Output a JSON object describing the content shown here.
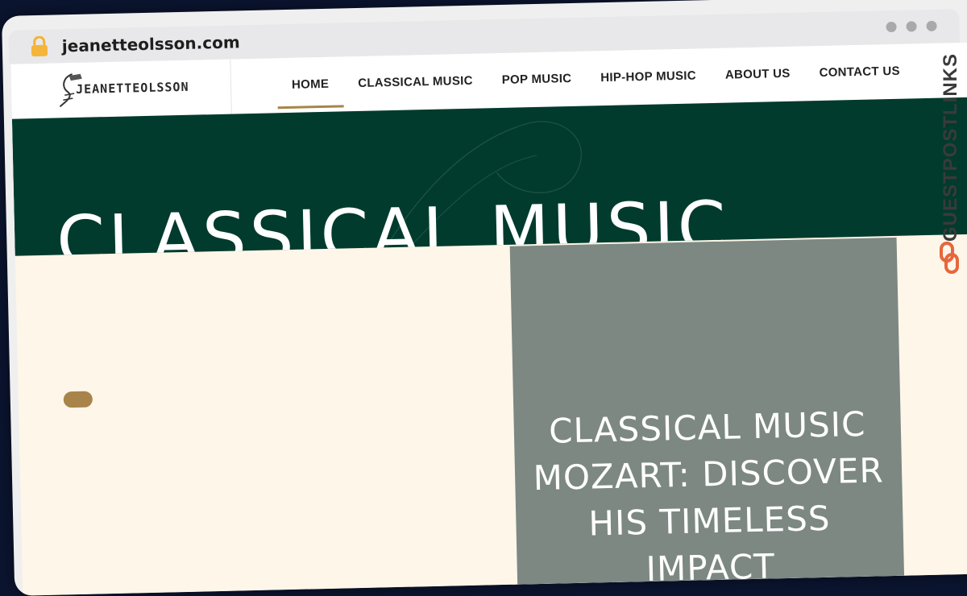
{
  "browser": {
    "url": "jeanetteolsson.com",
    "lock_icon": "lock-icon",
    "window_dots": 3
  },
  "site": {
    "logo_text": "JEANETTEOLSSON",
    "nav": [
      {
        "label": "HOME",
        "active": true
      },
      {
        "label": "CLASSICAL MUSIC",
        "active": false
      },
      {
        "label": "POP MUSIC",
        "active": false
      },
      {
        "label": "HIP-HOP MUSIC",
        "active": false
      },
      {
        "label": "ABOUT US",
        "active": false
      },
      {
        "label": "CONTACT US",
        "active": false
      }
    ],
    "hero_title": "CLASSICAL MUSIC",
    "card_title": "CLASSICAL MUSIC MOZART: DISCOVER HIS TIMELESS IMPACT"
  },
  "watermark": {
    "text": "GUESTPOSTLINKS"
  },
  "colors": {
    "hero_bg": "#013b2d",
    "page_bg": "#fdf6e9",
    "accent": "#a8844a",
    "card_bg": "#7d8883",
    "watermark_icon": "#e8663d"
  }
}
